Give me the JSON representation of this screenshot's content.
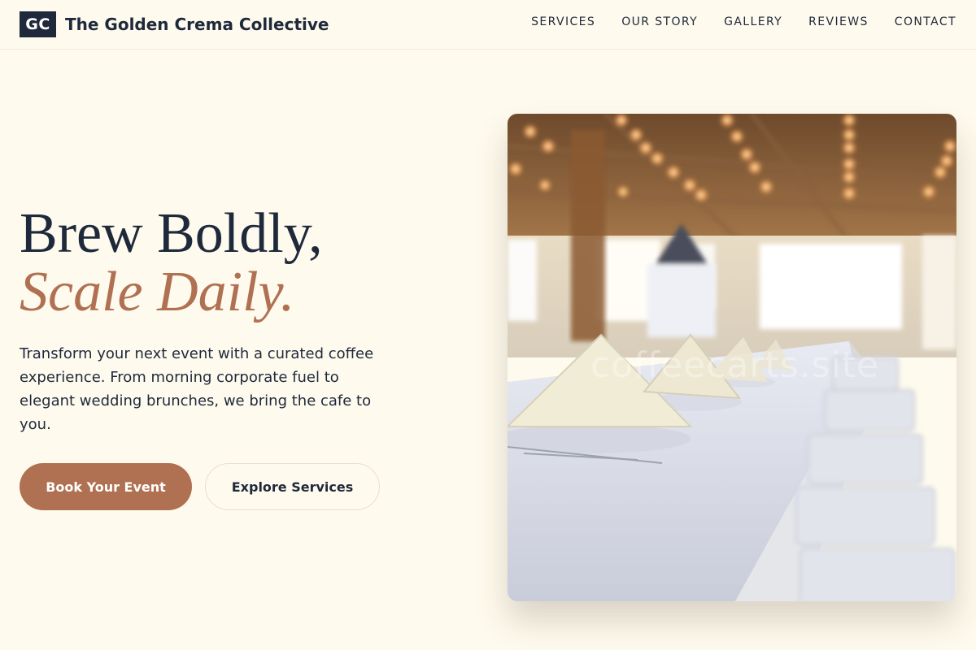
{
  "nav": {
    "logo_text": "GC",
    "brand_name": "The Golden Crema Collective",
    "links": [
      "SERVICES",
      "OUR STORY",
      "GALLERY",
      "REVIEWS",
      "CONTACT"
    ]
  },
  "hero": {
    "title_line1": "Brew Boldly,",
    "title_line2": "Scale Daily.",
    "description": "Transform your next event with a curated coffee experience. From morning corporate fuel to elegant wedding brunches, we bring the cafe to you.",
    "primary_cta": "Book Your Event",
    "secondary_cta": "Explore Services",
    "image_watermark": "coffeecarts.site"
  },
  "colors": {
    "background": "#fefaed",
    "text": "#1e293b",
    "accent": "#b07152"
  }
}
